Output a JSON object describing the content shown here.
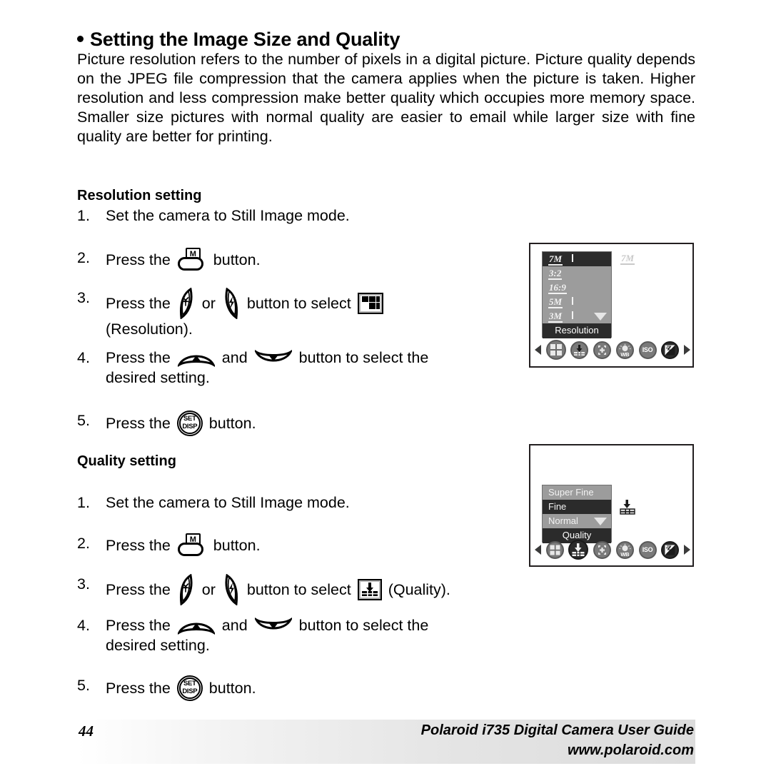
{
  "heading": {
    "title": "Setting the Image Size and Quality",
    "bullet": "bullet-dot"
  },
  "intro": {
    "paragraph": "Picture resolution refers to the number of pixels in a digital picture. Picture quality depends on the JPEG file compression that the camera applies when the picture is taken. Higher resolution and less compression make better quality which occupies more memory space. Smaller size pictures with normal quality are easier to email while larger size with fine quality are better for printing."
  },
  "resolution_section": {
    "subhead": "Resolution setting",
    "steps": [
      {
        "num": "1.",
        "text": "Set the camera to Still Image mode."
      },
      {
        "num": "2.",
        "pre": "Press the",
        "post": "button."
      },
      {
        "num": "3.",
        "pre": "Press the",
        "mid": "or",
        "post": "button to select",
        "tail": "",
        "line2": "(Resolution)."
      },
      {
        "num": "4.",
        "pre": "Press the",
        "mid": "and",
        "post": "button to select the",
        "line2": "desired setting."
      },
      {
        "num": "5.",
        "pre": "Press the",
        "post": "button."
      }
    ]
  },
  "quality_section": {
    "subhead": "Quality setting",
    "steps": [
      {
        "num": "1.",
        "text": "Set the camera to Still Image mode."
      },
      {
        "num": "2.",
        "pre": "Press the",
        "post": "button."
      },
      {
        "num": "3.",
        "pre": "Press the",
        "mid": "or",
        "post": "button to select",
        "tail": "(Quality)."
      },
      {
        "num": "4.",
        "pre": "Press the",
        "mid": "and",
        "post": "button to select the",
        "line2": "desired setting."
      },
      {
        "num": "5.",
        "pre": "Press the",
        "post": "button."
      }
    ]
  },
  "buttons": {
    "mode_label": "M",
    "setdisp_line1": "SET",
    "setdisp_line2": "DISP"
  },
  "lcd_resolution": {
    "menu_items": [
      {
        "label": "7M",
        "selected": true,
        "style": "mp"
      },
      {
        "label": "3:2",
        "selected": false,
        "style": "ratio"
      },
      {
        "label": "16:9",
        "selected": false,
        "style": "ratio"
      },
      {
        "label": "5M",
        "selected": false,
        "style": "mp"
      },
      {
        "label": "3M",
        "selected": false,
        "style": "mp"
      }
    ],
    "footer_label": "Resolution",
    "ghost_indicator": "7M",
    "scroll_caret": "caret-down-icon",
    "strip_icons": [
      {
        "name": "resolution-icon",
        "label": "",
        "highlighted": false
      },
      {
        "name": "quality-icon",
        "label": "",
        "highlighted": false
      },
      {
        "name": "focus-icon",
        "label": "",
        "highlighted": false
      },
      {
        "name": "white-balance-icon",
        "label": "WB",
        "highlighted": false
      },
      {
        "name": "iso-icon",
        "label": "ISO",
        "highlighted": false
      },
      {
        "name": "ev-compensation-icon",
        "label": "",
        "highlighted": true
      }
    ]
  },
  "lcd_quality": {
    "menu_items": [
      {
        "label": "Super Fine",
        "selected": false
      },
      {
        "label": "Fine",
        "selected": true
      },
      {
        "label": "Normal",
        "selected": false
      }
    ],
    "footer_label": "Quality",
    "scroll_caret": "caret-down-icon",
    "strip_icons": [
      {
        "name": "resolution-icon",
        "label": "",
        "highlighted": false
      },
      {
        "name": "quality-icon",
        "label": "",
        "highlighted": true
      },
      {
        "name": "focus-icon",
        "label": "",
        "highlighted": false
      },
      {
        "name": "white-balance-icon",
        "label": "WB",
        "highlighted": false
      },
      {
        "name": "iso-icon",
        "label": "ISO",
        "highlighted": false
      },
      {
        "name": "ev-compensation-icon",
        "label": "",
        "highlighted": true
      }
    ]
  },
  "footer": {
    "page_number": "44",
    "guide_title": "Polaroid i735 Digital Camera User Guide",
    "url": "www.polaroid.com"
  }
}
